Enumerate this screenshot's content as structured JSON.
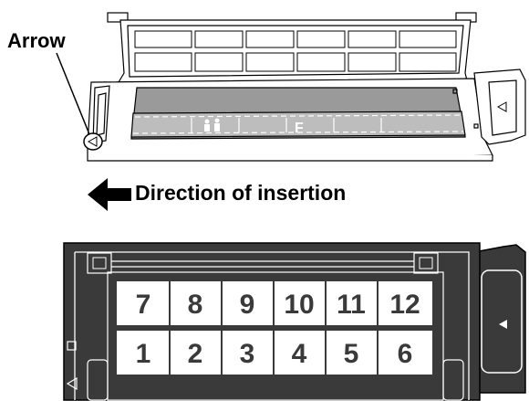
{
  "labels": {
    "arrow": "Arrow",
    "direction": "Direction of insertion"
  },
  "frames": {
    "top_row": [
      "7",
      "8",
      "9",
      "10",
      "11",
      "12"
    ],
    "bottom_row": [
      "1",
      "2",
      "3",
      "4",
      "5",
      "6"
    ]
  },
  "top_holder_frame_mark": "F",
  "colors": {
    "holder_fill": "#3a3a3a",
    "tray_fill": "#9a9a9a",
    "line": "#000000",
    "outline_light": "#ffffff"
  }
}
